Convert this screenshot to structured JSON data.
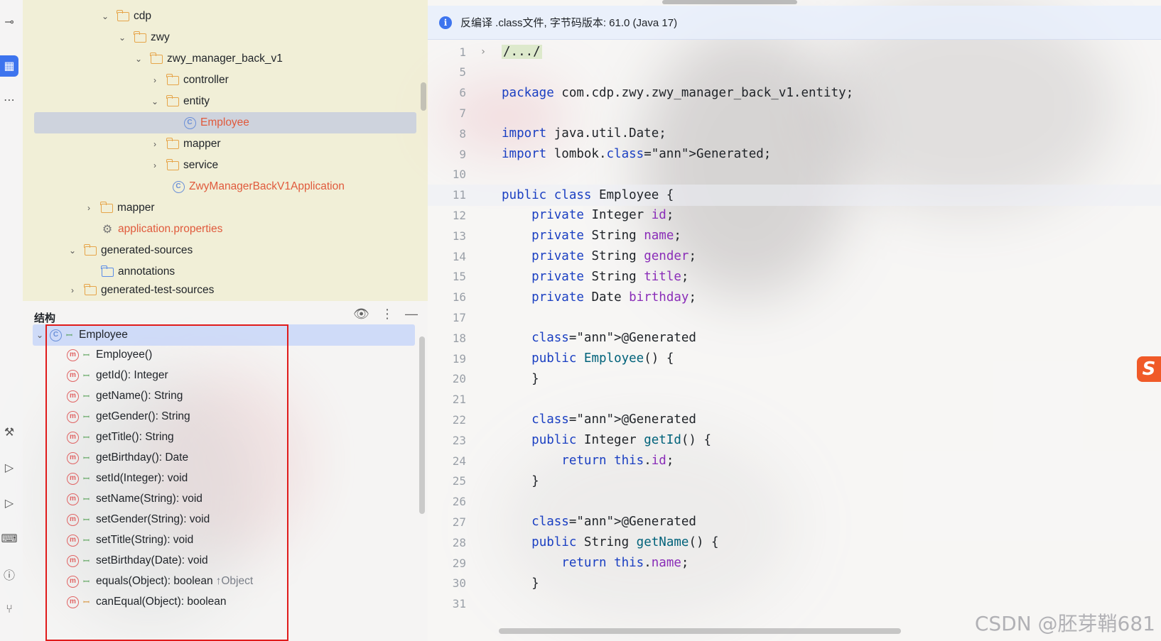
{
  "activity_bar": {
    "icons": [
      "commit-icon",
      "structure-icon",
      "more-icon",
      "build-icon",
      "run-icon",
      "debug-icon",
      "terminal-icon",
      "problems-icon",
      "git-icon"
    ]
  },
  "project_tree": {
    "items": [
      {
        "label": "cdp",
        "type": "folder",
        "expanded": true
      },
      {
        "label": "zwy",
        "type": "folder",
        "expanded": true
      },
      {
        "label": "zwy_manager_back_v1",
        "type": "folder",
        "expanded": true
      },
      {
        "label": "controller",
        "type": "folder",
        "expanded": false
      },
      {
        "label": "entity",
        "type": "folder",
        "expanded": true
      },
      {
        "label": "Employee",
        "type": "class",
        "selected": true
      },
      {
        "label": "mapper",
        "type": "folder",
        "expanded": false
      },
      {
        "label": "service",
        "type": "folder",
        "expanded": false
      },
      {
        "label": "ZwyManagerBackV1Application",
        "type": "spring-class"
      },
      {
        "label": "mapper",
        "type": "folder",
        "expanded": false
      },
      {
        "label": "application.properties",
        "type": "config"
      },
      {
        "label": "generated-sources",
        "type": "folder",
        "expanded": true
      },
      {
        "label": "annotations",
        "type": "generated-folder"
      },
      {
        "label": "generated-test-sources",
        "type": "folder",
        "expanded": false
      }
    ]
  },
  "structure_panel": {
    "title": "结构",
    "root": "Employee",
    "members": [
      {
        "label": "Employee()",
        "access": "public"
      },
      {
        "label": "getId(): Integer",
        "access": "public"
      },
      {
        "label": "getName(): String",
        "access": "public"
      },
      {
        "label": "getGender(): String",
        "access": "public"
      },
      {
        "label": "getTitle(): String",
        "access": "public"
      },
      {
        "label": "getBirthday(): Date",
        "access": "public"
      },
      {
        "label": "setId(Integer): void",
        "access": "public"
      },
      {
        "label": "setName(String): void",
        "access": "public"
      },
      {
        "label": "setGender(String): void",
        "access": "public"
      },
      {
        "label": "setTitle(String): void",
        "access": "public"
      },
      {
        "label": "setBirthday(Date): void",
        "access": "public"
      },
      {
        "label": "equals(Object): boolean",
        "access": "public",
        "inherit": "↑Object"
      },
      {
        "label": "canEqual(Object): boolean",
        "access": "protected"
      }
    ]
  },
  "editor": {
    "banner": "反编译 .class文件, 字节码版本: 61.0 (Java 17)",
    "lines": [
      {
        "n": "1",
        "fold": "›",
        "text": "/.../"
      },
      {
        "n": "5",
        "text": ""
      },
      {
        "n": "6",
        "text": "package com.cdp.zwy.zwy_manager_back_v1.entity;"
      },
      {
        "n": "7",
        "text": ""
      },
      {
        "n": "8",
        "text": "import java.util.Date;"
      },
      {
        "n": "9",
        "text": "import lombok.Generated;"
      },
      {
        "n": "10",
        "text": ""
      },
      {
        "n": "11",
        "text": "public class Employee {"
      },
      {
        "n": "12",
        "text": "    private Integer id;"
      },
      {
        "n": "13",
        "text": "    private String name;"
      },
      {
        "n": "14",
        "text": "    private String gender;"
      },
      {
        "n": "15",
        "text": "    private String title;"
      },
      {
        "n": "16",
        "text": "    private Date birthday;"
      },
      {
        "n": "17",
        "text": ""
      },
      {
        "n": "18",
        "text": "    @Generated"
      },
      {
        "n": "19",
        "text": "    public Employee() {"
      },
      {
        "n": "20",
        "text": "    }"
      },
      {
        "n": "21",
        "text": ""
      },
      {
        "n": "22",
        "text": "    @Generated"
      },
      {
        "n": "23",
        "text": "    public Integer getId() {"
      },
      {
        "n": "24",
        "text": "        return this.id;"
      },
      {
        "n": "25",
        "text": "    }"
      },
      {
        "n": "26",
        "text": ""
      },
      {
        "n": "27",
        "text": "    @Generated"
      },
      {
        "n": "28",
        "text": "    public String getName() {"
      },
      {
        "n": "29",
        "text": "        return this.name;"
      },
      {
        "n": "30",
        "text": "    }"
      },
      {
        "n": "31",
        "text": ""
      }
    ]
  },
  "watermark": "CSDN @胚芽鞘681",
  "colors": {
    "accent": "#3d74ee",
    "keyword": "#1a3fc2",
    "annotation": "#9e880d",
    "field": "#8a2db8",
    "method": "#00627a",
    "highlight_box": "#e01b1b"
  }
}
